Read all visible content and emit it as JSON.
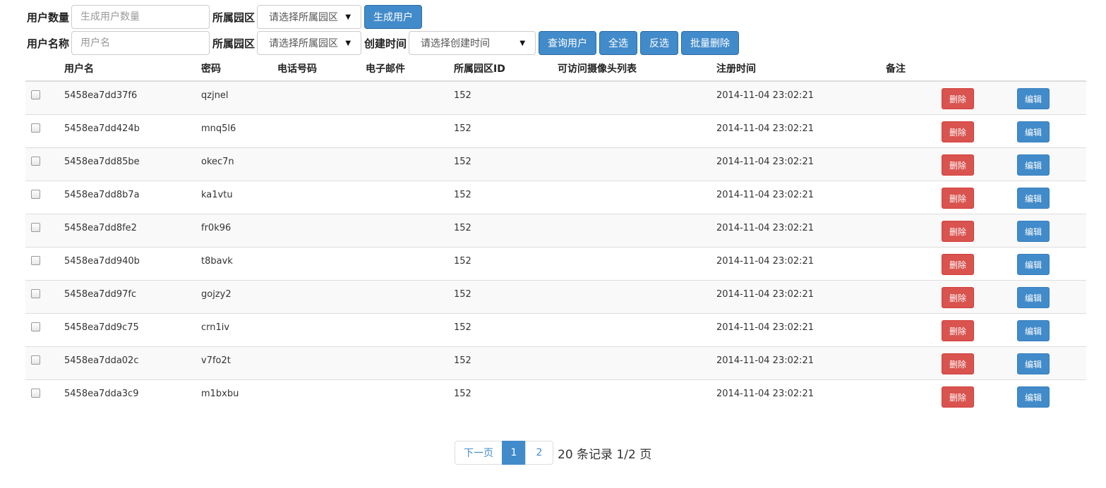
{
  "filters": {
    "row1": {
      "count_label": "用户数量",
      "count_placeholder": "生成用户数量",
      "park_label": "所属园区",
      "park_select": "请选择所属园区",
      "generate_btn": "生成用户"
    },
    "row2": {
      "name_label": "用户名称",
      "name_placeholder": "用户名",
      "park_label": "所属园区",
      "park_select": "请选择所属园区",
      "time_label": "创建时间",
      "time_select": "请选择创建时间",
      "query_btn": "查询用户",
      "select_all_btn": "全选",
      "invert_btn": "反选",
      "batch_delete_btn": "批量删除"
    }
  },
  "table": {
    "headers": [
      "用户名",
      "密码",
      "电话号码",
      "电子邮件",
      "所属园区ID",
      "可访问摄像头列表",
      "注册时间",
      "备注"
    ],
    "delete_label": "删除",
    "edit_label": "编辑",
    "rows": [
      {
        "username": "5458ea7dd37f6",
        "password": "qzjnel",
        "phone": "",
        "email": "",
        "park_id": "152",
        "cameras": "",
        "reg_time": "2014-11-04 23:02:21",
        "note": ""
      },
      {
        "username": "5458ea7dd424b",
        "password": "mnq5l6",
        "phone": "",
        "email": "",
        "park_id": "152",
        "cameras": "",
        "reg_time": "2014-11-04 23:02:21",
        "note": ""
      },
      {
        "username": "5458ea7dd85be",
        "password": "okec7n",
        "phone": "",
        "email": "",
        "park_id": "152",
        "cameras": "",
        "reg_time": "2014-11-04 23:02:21",
        "note": ""
      },
      {
        "username": "5458ea7dd8b7a",
        "password": "ka1vtu",
        "phone": "",
        "email": "",
        "park_id": "152",
        "cameras": "",
        "reg_time": "2014-11-04 23:02:21",
        "note": ""
      },
      {
        "username": "5458ea7dd8fe2",
        "password": "fr0k96",
        "phone": "",
        "email": "",
        "park_id": "152",
        "cameras": "",
        "reg_time": "2014-11-04 23:02:21",
        "note": ""
      },
      {
        "username": "5458ea7dd940b",
        "password": "t8bavk",
        "phone": "",
        "email": "",
        "park_id": "152",
        "cameras": "",
        "reg_time": "2014-11-04 23:02:21",
        "note": ""
      },
      {
        "username": "5458ea7dd97fc",
        "password": "gojzy2",
        "phone": "",
        "email": "",
        "park_id": "152",
        "cameras": "",
        "reg_time": "2014-11-04 23:02:21",
        "note": ""
      },
      {
        "username": "5458ea7dd9c75",
        "password": "crn1iv",
        "phone": "",
        "email": "",
        "park_id": "152",
        "cameras": "",
        "reg_time": "2014-11-04 23:02:21",
        "note": ""
      },
      {
        "username": "5458ea7dda02c",
        "password": "v7fo2t",
        "phone": "",
        "email": "",
        "park_id": "152",
        "cameras": "",
        "reg_time": "2014-11-04 23:02:21",
        "note": ""
      },
      {
        "username": "5458ea7dda3c9",
        "password": "m1bxbu",
        "phone": "",
        "email": "",
        "park_id": "152",
        "cameras": "",
        "reg_time": "2014-11-04 23:02:21",
        "note": ""
      }
    ]
  },
  "pagination": {
    "next_label": "下一页",
    "pages": [
      "1",
      "2"
    ],
    "active_page": "1",
    "summary": "20 条记录 1/2 页"
  },
  "colors": {
    "primary": "#428bca",
    "danger": "#d9534f"
  },
  "icons": {
    "select_caret": "caret-down-icon"
  }
}
